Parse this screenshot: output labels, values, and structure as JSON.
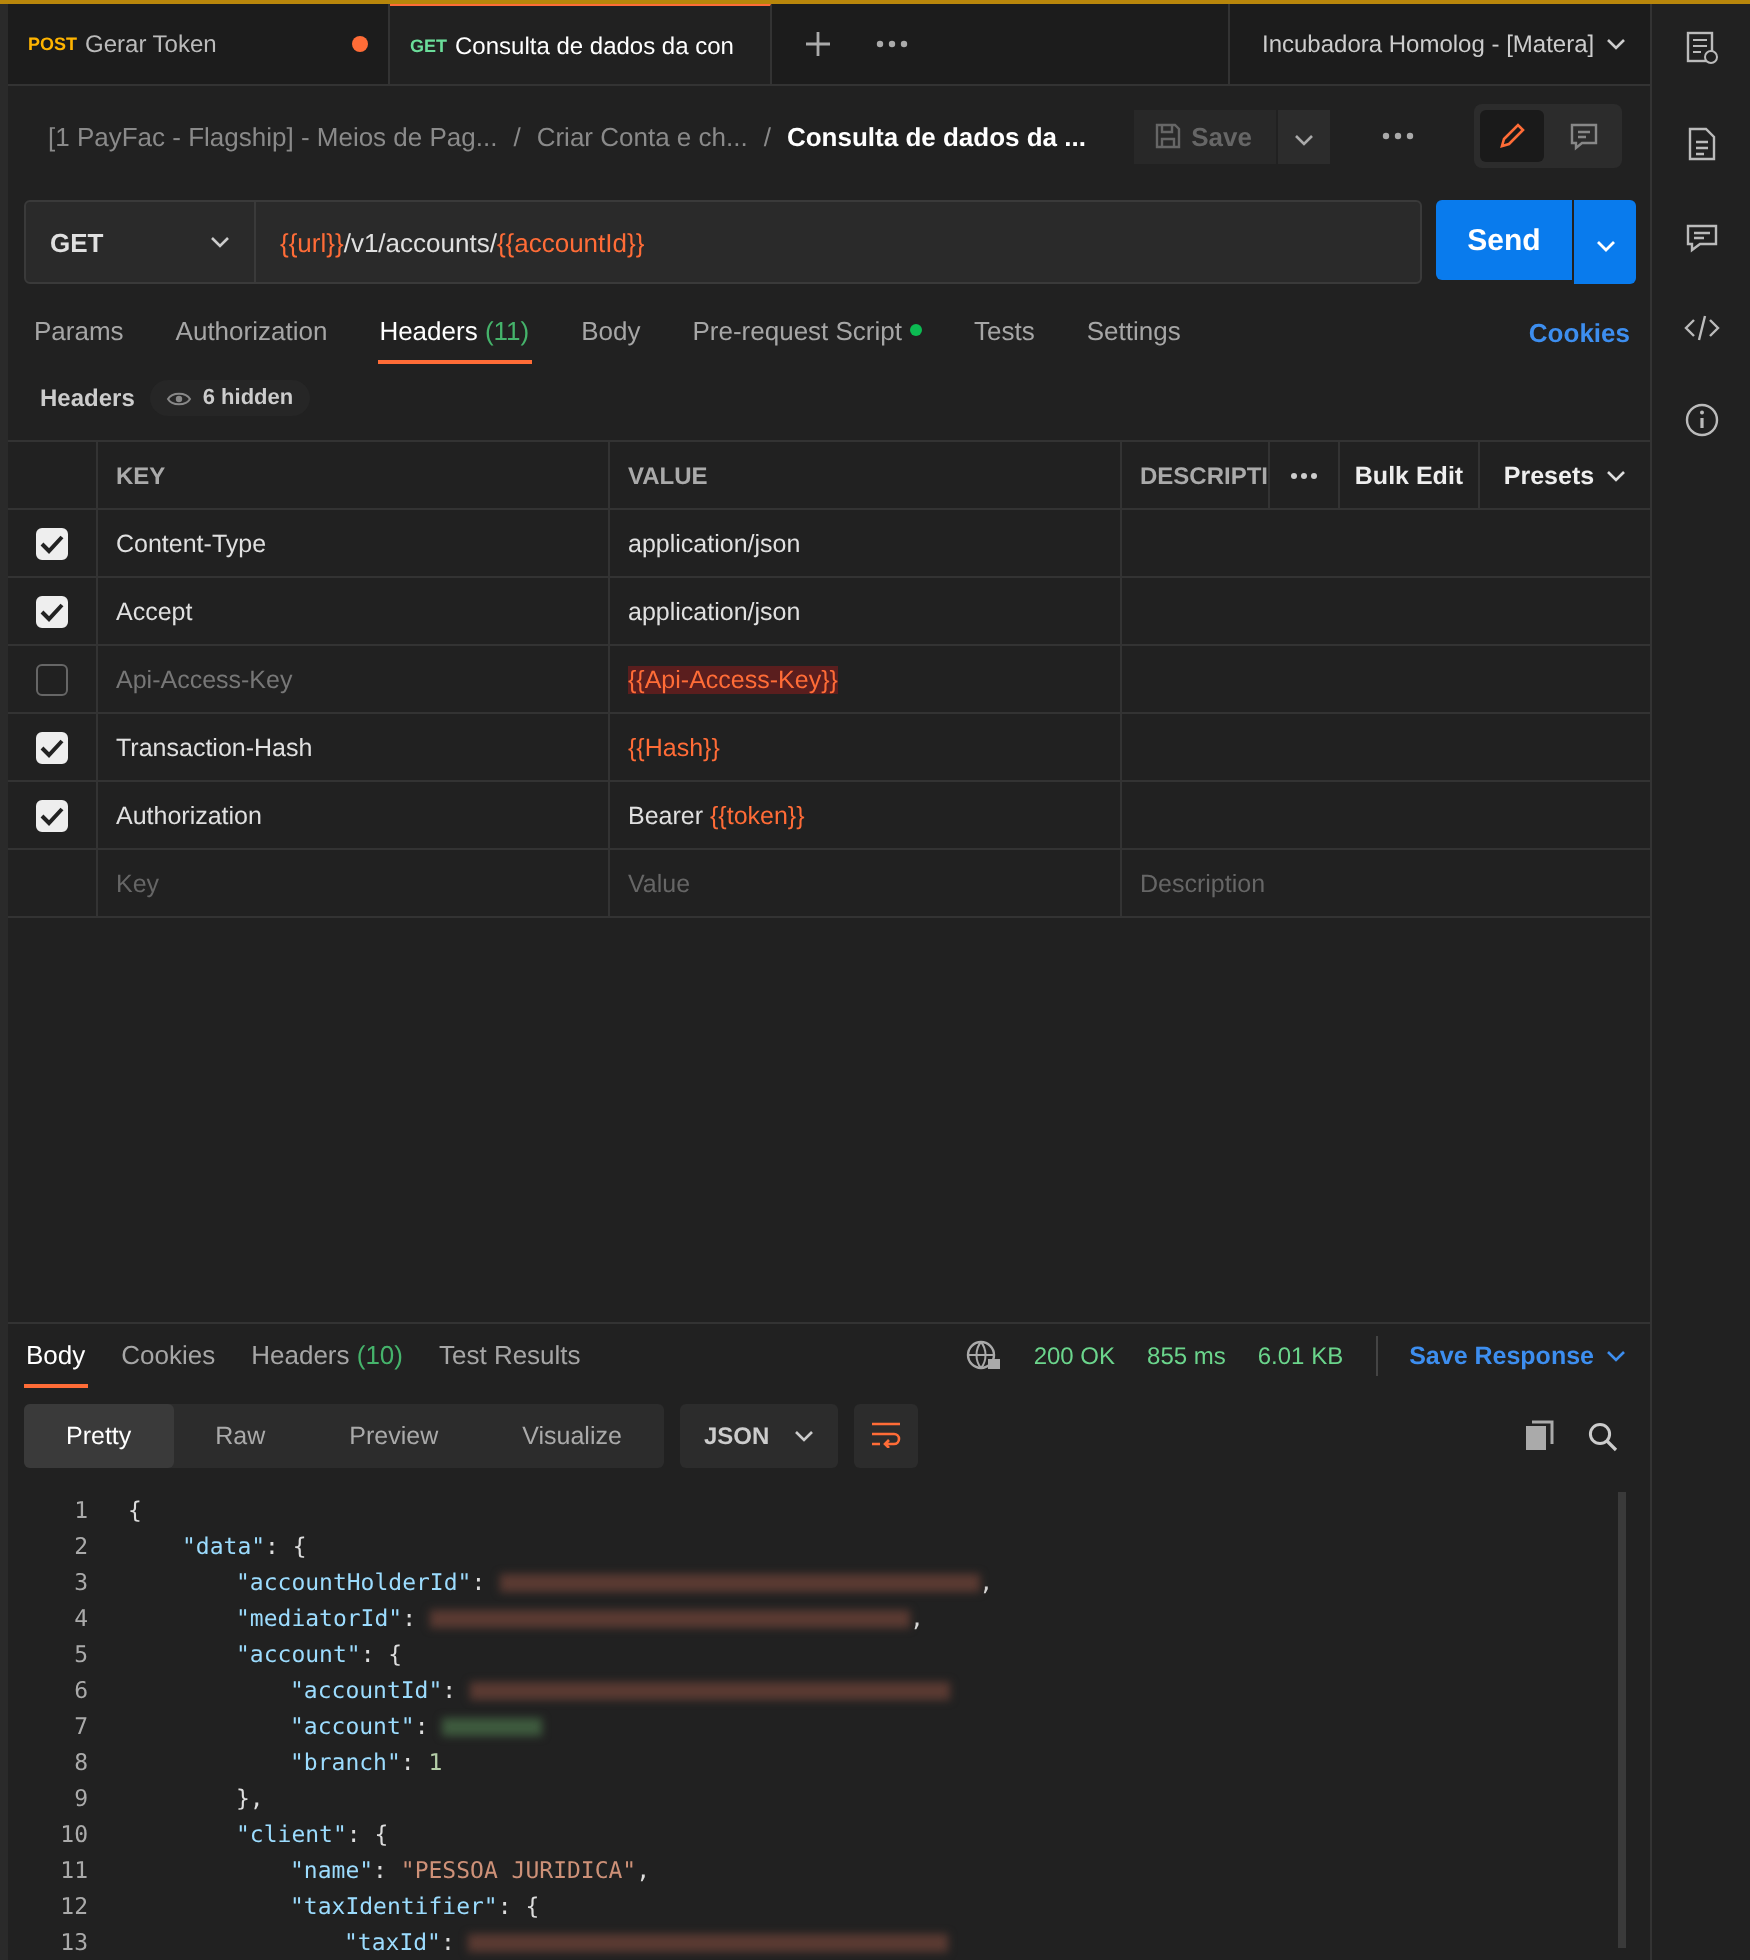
{
  "tabs": [
    {
      "method": "POST",
      "name": "Gerar Token",
      "selected": false,
      "unsaved": true
    },
    {
      "method": "GET",
      "name": "Consulta de dados da con",
      "selected": true,
      "unsaved": false
    }
  ],
  "environment": "Incubadora Homolog - [Matera]",
  "breadcrumb": [
    {
      "text": "[1 PayFac - Flagship] - Meios de Pag..."
    },
    {
      "separator": "/",
      "text": "Criar Conta e ch..."
    },
    {
      "separator": "/",
      "text": "Consulta de dados da ..."
    }
  ],
  "save_label": "Save",
  "request": {
    "method": "GET",
    "url": [
      {
        "kind": "var",
        "text": "{{url}}"
      },
      {
        "kind": "text",
        "text": "/v1/accounts/"
      },
      {
        "kind": "var",
        "text": "{{accountId}}"
      }
    ],
    "send_label": "Send"
  },
  "request_tabs": [
    {
      "label": "Params",
      "dot": false,
      "selected": false
    },
    {
      "label": "Authorization",
      "dot": false,
      "selected": false
    },
    {
      "label": "Headers",
      "count": "(11)",
      "dot": false,
      "selected": true
    },
    {
      "label": "Body",
      "dot": false,
      "selected": false
    },
    {
      "label": "Pre-request Script",
      "dot": true,
      "selected": false
    },
    {
      "label": "Tests",
      "dot": false,
      "selected": false
    },
    {
      "label": "Settings",
      "dot": false,
      "selected": false
    }
  ],
  "cookies_link": "Cookies",
  "headers_label": "Headers",
  "hidden_badge": "6 hidden",
  "table": {
    "columns": [
      "KEY",
      "VALUE",
      "DESCRIPTI"
    ],
    "bulk_edit": "Bulk Edit",
    "presets": "Presets",
    "rows": [
      {
        "checked": true,
        "key": "Content-Type",
        "value": [
          {
            "kind": "text",
            "text": "application/json"
          }
        ]
      },
      {
        "checked": true,
        "key": "Accept",
        "value": [
          {
            "kind": "text",
            "text": "application/json"
          }
        ]
      },
      {
        "checked": false,
        "key": "Api-Access-Key",
        "value": [
          {
            "kind": "unresolved",
            "text": "{{Api-Access-Key}}"
          }
        ]
      },
      {
        "checked": true,
        "key": "Transaction-Hash",
        "value": [
          {
            "kind": "var",
            "text": "{{Hash}}"
          }
        ]
      },
      {
        "checked": true,
        "key": "Authorization",
        "value": [
          {
            "kind": "text",
            "text": "Bearer "
          },
          {
            "kind": "var",
            "text": "{{token}}"
          }
        ]
      }
    ],
    "new_row": {
      "key_placeholder": "Key",
      "value_placeholder": "Value",
      "description_placeholder": "Description"
    }
  },
  "response": {
    "tabs": [
      {
        "label": "Body",
        "selected": true
      },
      {
        "label": "Cookies",
        "selected": false
      },
      {
        "label": "Headers",
        "count": "(10)",
        "selected": false
      },
      {
        "label": "Test Results",
        "selected": false
      }
    ],
    "status": "200 OK",
    "time": "855 ms",
    "size": "6.01 KB",
    "save_response": "Save Response",
    "views": [
      {
        "label": "Pretty",
        "selected": true
      },
      {
        "label": "Raw",
        "selected": false
      },
      {
        "label": "Preview",
        "selected": false
      },
      {
        "label": "Visualize",
        "selected": false
      }
    ],
    "format": "JSON",
    "code": [
      {
        "num": "1",
        "parts": [
          {
            "kind": "punct",
            "text": "{"
          }
        ],
        "children": [
          {
            "num": "2",
            "parts": [
              {
                "kind": "key",
                "text": "\"data\""
              },
              {
                "kind": "punct",
                "text": ": {"
              }
            ],
            "children": [
              {
                "num": "3",
                "parts": [
                  {
                    "kind": "key",
                    "text": "\"accountHolderId\""
                  },
                  {
                    "kind": "punct",
                    "text": ": "
                  },
                  {
                    "kind": "redacted_string"
                  },
                  {
                    "kind": "punct",
                    "text": ","
                  }
                ]
              },
              {
                "num": "4",
                "parts": [
                  {
                    "kind": "key",
                    "text": "\"mediatorId\""
                  },
                  {
                    "kind": "punct",
                    "text": ": "
                  },
                  {
                    "kind": "redacted_string"
                  },
                  {
                    "kind": "punct",
                    "text": ","
                  }
                ]
              },
              {
                "num": "5",
                "parts": [
                  {
                    "kind": "key",
                    "text": "\"account\""
                  },
                  {
                    "kind": "punct",
                    "text": ": {"
                  }
                ],
                "children": [
                  {
                    "num": "6",
                    "parts": [
                      {
                        "kind": "key",
                        "text": "\"accountId\""
                      },
                      {
                        "kind": "punct",
                        "text": ": "
                      },
                      {
                        "kind": "redacted_string"
                      }
                    ]
                  },
                  {
                    "num": "7",
                    "parts": [
                      {
                        "kind": "key",
                        "text": "\"account\""
                      },
                      {
                        "kind": "punct",
                        "text": ": "
                      },
                      {
                        "kind": "redacted_number"
                      }
                    ]
                  },
                  {
                    "num": "8",
                    "parts": [
                      {
                        "kind": "key",
                        "text": "\"branch\""
                      },
                      {
                        "kind": "punct",
                        "text": ": "
                      },
                      {
                        "kind": "number",
                        "text": "1"
                      }
                    ]
                  }
                ]
              },
              {
                "num": "9",
                "parts": [
                  {
                    "kind": "punct",
                    "text": "},"
                  }
                ]
              },
              {
                "num": "10",
                "parts": [
                  {
                    "kind": "key",
                    "text": "\"client\""
                  },
                  {
                    "kind": "punct",
                    "text": ": {"
                  }
                ],
                "children": [
                  {
                    "num": "11",
                    "parts": [
                      {
                        "kind": "key",
                        "text": "\"name\""
                      },
                      {
                        "kind": "punct",
                        "text": ": "
                      },
                      {
                        "kind": "string",
                        "text": "\"PESSOA JURIDICA\""
                      },
                      {
                        "kind": "punct",
                        "text": ","
                      }
                    ]
                  },
                  {
                    "num": "12",
                    "parts": [
                      {
                        "kind": "key",
                        "text": "\"taxIdentifier\""
                      },
                      {
                        "kind": "punct",
                        "text": ": {"
                      }
                    ],
                    "children": [
                      {
                        "num": "13",
                        "parts": [
                          {
                            "kind": "key",
                            "text": "\"taxId\""
                          },
                          {
                            "kind": "punct",
                            "text": ": "
                          },
                          {
                            "kind": "redacted_string"
                          }
                        ]
                      }
                    ]
                  }
                ]
              }
            ]
          }
        ]
      }
    ]
  }
}
